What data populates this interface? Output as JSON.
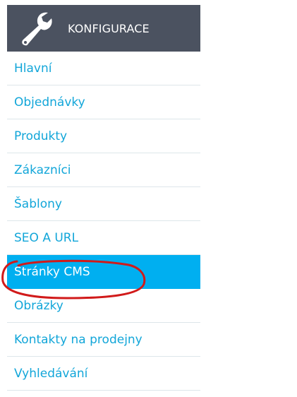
{
  "header": {
    "title": "KONFIGURACE",
    "icon": "wrench-icon"
  },
  "menu": {
    "items": [
      {
        "label": "Hlavní"
      },
      {
        "label": "Objednávky"
      },
      {
        "label": "Produkty"
      },
      {
        "label": "Zákazníci"
      },
      {
        "label": "Šablony"
      },
      {
        "label": "SEO A URL"
      },
      {
        "label": "Stránky CMS",
        "active": true
      },
      {
        "label": "Obrázky"
      },
      {
        "label": "Kontakty na prodejny"
      },
      {
        "label": "Vyhledávání"
      }
    ]
  },
  "colors": {
    "header_bg": "#4b5260",
    "link": "#12a6d9",
    "active_bg": "#00aff0",
    "annotation": "#d11a1a"
  }
}
